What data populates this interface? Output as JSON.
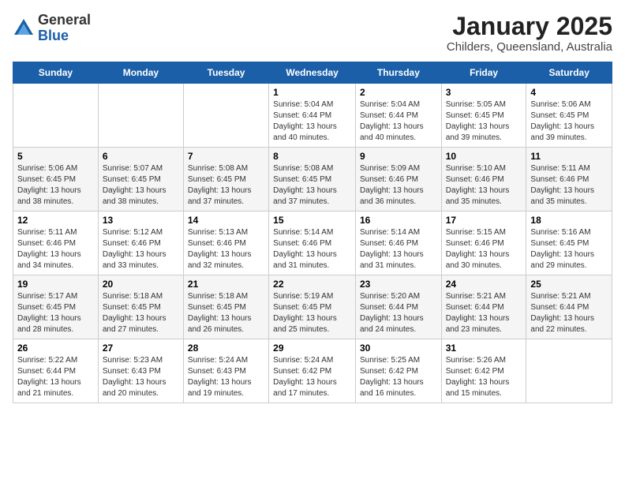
{
  "logo": {
    "general": "General",
    "blue": "Blue"
  },
  "title": "January 2025",
  "subtitle": "Childers, Queensland, Australia",
  "days_of_week": [
    "Sunday",
    "Monday",
    "Tuesday",
    "Wednesday",
    "Thursday",
    "Friday",
    "Saturday"
  ],
  "weeks": [
    [
      {
        "day": "",
        "detail": ""
      },
      {
        "day": "",
        "detail": ""
      },
      {
        "day": "",
        "detail": ""
      },
      {
        "day": "1",
        "detail": "Sunrise: 5:04 AM\nSunset: 6:44 PM\nDaylight: 13 hours\nand 40 minutes."
      },
      {
        "day": "2",
        "detail": "Sunrise: 5:04 AM\nSunset: 6:44 PM\nDaylight: 13 hours\nand 40 minutes."
      },
      {
        "day": "3",
        "detail": "Sunrise: 5:05 AM\nSunset: 6:45 PM\nDaylight: 13 hours\nand 39 minutes."
      },
      {
        "day": "4",
        "detail": "Sunrise: 5:06 AM\nSunset: 6:45 PM\nDaylight: 13 hours\nand 39 minutes."
      }
    ],
    [
      {
        "day": "5",
        "detail": "Sunrise: 5:06 AM\nSunset: 6:45 PM\nDaylight: 13 hours\nand 38 minutes."
      },
      {
        "day": "6",
        "detail": "Sunrise: 5:07 AM\nSunset: 6:45 PM\nDaylight: 13 hours\nand 38 minutes."
      },
      {
        "day": "7",
        "detail": "Sunrise: 5:08 AM\nSunset: 6:45 PM\nDaylight: 13 hours\nand 37 minutes."
      },
      {
        "day": "8",
        "detail": "Sunrise: 5:08 AM\nSunset: 6:45 PM\nDaylight: 13 hours\nand 37 minutes."
      },
      {
        "day": "9",
        "detail": "Sunrise: 5:09 AM\nSunset: 6:46 PM\nDaylight: 13 hours\nand 36 minutes."
      },
      {
        "day": "10",
        "detail": "Sunrise: 5:10 AM\nSunset: 6:46 PM\nDaylight: 13 hours\nand 35 minutes."
      },
      {
        "day": "11",
        "detail": "Sunrise: 5:11 AM\nSunset: 6:46 PM\nDaylight: 13 hours\nand 35 minutes."
      }
    ],
    [
      {
        "day": "12",
        "detail": "Sunrise: 5:11 AM\nSunset: 6:46 PM\nDaylight: 13 hours\nand 34 minutes."
      },
      {
        "day": "13",
        "detail": "Sunrise: 5:12 AM\nSunset: 6:46 PM\nDaylight: 13 hours\nand 33 minutes."
      },
      {
        "day": "14",
        "detail": "Sunrise: 5:13 AM\nSunset: 6:46 PM\nDaylight: 13 hours\nand 32 minutes."
      },
      {
        "day": "15",
        "detail": "Sunrise: 5:14 AM\nSunset: 6:46 PM\nDaylight: 13 hours\nand 31 minutes."
      },
      {
        "day": "16",
        "detail": "Sunrise: 5:14 AM\nSunset: 6:46 PM\nDaylight: 13 hours\nand 31 minutes."
      },
      {
        "day": "17",
        "detail": "Sunrise: 5:15 AM\nSunset: 6:46 PM\nDaylight: 13 hours\nand 30 minutes."
      },
      {
        "day": "18",
        "detail": "Sunrise: 5:16 AM\nSunset: 6:45 PM\nDaylight: 13 hours\nand 29 minutes."
      }
    ],
    [
      {
        "day": "19",
        "detail": "Sunrise: 5:17 AM\nSunset: 6:45 PM\nDaylight: 13 hours\nand 28 minutes."
      },
      {
        "day": "20",
        "detail": "Sunrise: 5:18 AM\nSunset: 6:45 PM\nDaylight: 13 hours\nand 27 minutes."
      },
      {
        "day": "21",
        "detail": "Sunrise: 5:18 AM\nSunset: 6:45 PM\nDaylight: 13 hours\nand 26 minutes."
      },
      {
        "day": "22",
        "detail": "Sunrise: 5:19 AM\nSunset: 6:45 PM\nDaylight: 13 hours\nand 25 minutes."
      },
      {
        "day": "23",
        "detail": "Sunrise: 5:20 AM\nSunset: 6:44 PM\nDaylight: 13 hours\nand 24 minutes."
      },
      {
        "day": "24",
        "detail": "Sunrise: 5:21 AM\nSunset: 6:44 PM\nDaylight: 13 hours\nand 23 minutes."
      },
      {
        "day": "25",
        "detail": "Sunrise: 5:21 AM\nSunset: 6:44 PM\nDaylight: 13 hours\nand 22 minutes."
      }
    ],
    [
      {
        "day": "26",
        "detail": "Sunrise: 5:22 AM\nSunset: 6:44 PM\nDaylight: 13 hours\nand 21 minutes."
      },
      {
        "day": "27",
        "detail": "Sunrise: 5:23 AM\nSunset: 6:43 PM\nDaylight: 13 hours\nand 20 minutes."
      },
      {
        "day": "28",
        "detail": "Sunrise: 5:24 AM\nSunset: 6:43 PM\nDaylight: 13 hours\nand 19 minutes."
      },
      {
        "day": "29",
        "detail": "Sunrise: 5:24 AM\nSunset: 6:42 PM\nDaylight: 13 hours\nand 17 minutes."
      },
      {
        "day": "30",
        "detail": "Sunrise: 5:25 AM\nSunset: 6:42 PM\nDaylight: 13 hours\nand 16 minutes."
      },
      {
        "day": "31",
        "detail": "Sunrise: 5:26 AM\nSunset: 6:42 PM\nDaylight: 13 hours\nand 15 minutes."
      },
      {
        "day": "",
        "detail": ""
      }
    ]
  ]
}
